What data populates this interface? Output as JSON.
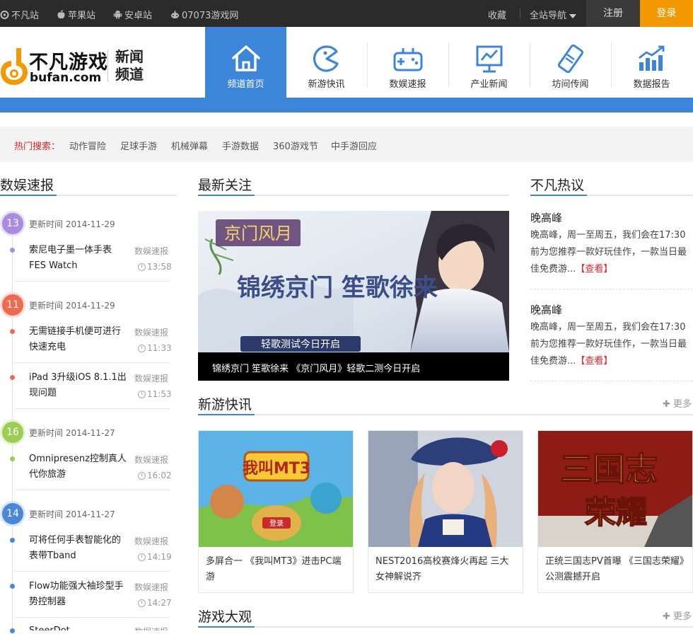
{
  "topbar": {
    "links": [
      {
        "label": "不凡站",
        "icon": "bufan-icon"
      },
      {
        "label": "苹果站",
        "icon": "apple-icon"
      },
      {
        "label": "安卓站",
        "icon": "android-icon"
      },
      {
        "label": "07073游戏网",
        "icon": "gamepad-icon"
      }
    ],
    "favorites": "收藏",
    "site_nav": "全站导航",
    "register": "注册",
    "login": "登录"
  },
  "header": {
    "logo_cn": "不凡游戏",
    "logo_en": "bufan.com",
    "channel": "新闻频道",
    "nav": [
      {
        "label": "频道首页",
        "icon": "home-icon",
        "active": true
      },
      {
        "label": "新游快讯",
        "icon": "pacman-icon",
        "active": false
      },
      {
        "label": "数娱速报",
        "icon": "gamepad-icon",
        "active": false
      },
      {
        "label": "产业新闻",
        "icon": "chart-monitor-icon",
        "active": false
      },
      {
        "label": "坊间传闻",
        "icon": "phone-icon",
        "active": false
      },
      {
        "label": "数据报告",
        "icon": "bar-chart-icon",
        "active": false
      }
    ]
  },
  "hot_search": {
    "label": "热门搜索：",
    "terms": [
      "动作冒险",
      "足球手游",
      "机械弹幕",
      "手游数据",
      "360游戏节",
      "中手游回应"
    ]
  },
  "left": {
    "title": "数娱速报",
    "date_prefix": "更新时间",
    "groups": [
      {
        "day": "13",
        "date": "2014-11-29",
        "color": "#a98be0",
        "items": [
          {
            "title": "索尼电子墨一体手表FES Watch",
            "cat": "数娱速报",
            "time": "13:58"
          }
        ]
      },
      {
        "day": "11",
        "date": "2014-11-29",
        "color": "#ef6a4e",
        "items": [
          {
            "title": "无需链接手机便可进行快速充电",
            "cat": "数娱速报",
            "time": "11:33"
          },
          {
            "title": "iPad 3升级iOS 8.1.1出现问题",
            "cat": "数娱速报",
            "time": "11:53"
          }
        ]
      },
      {
        "day": "16",
        "date": "2014-11-27",
        "color": "#9ccd55",
        "items": [
          {
            "title": "Omnipresenz控制真人代你旅游",
            "cat": "数娱速报",
            "time": "16:02"
          }
        ]
      },
      {
        "day": "14",
        "date": "2014-11-27",
        "color": "#4a87d6",
        "items": [
          {
            "title": "可将任何手表智能化的表带Tband",
            "cat": "数娱速报",
            "time": "14:19"
          },
          {
            "title": "Flow功能强大袖珍型手势控制器",
            "cat": "数娱速报",
            "time": "14:27"
          },
          {
            "title": "SteerDot…",
            "cat": "数据速报",
            "time": ""
          }
        ]
      }
    ]
  },
  "center": {
    "title": "最新关注",
    "banner_logo": "京门风月",
    "banner_headline": "锦绣京门 笙歌徐来",
    "banner_sub": "轻歌测试今日开启",
    "caption": "锦绣京门 笙歌徐来 《京门风月》轻歌二测今日开启",
    "newgames_title": "新游快讯",
    "more": "更多",
    "cards": [
      {
        "title": "多屏合一 《我叫MT3》进击PC端游",
        "art": "我叫MT3",
        "button": "登录"
      },
      {
        "title": "NEST2016高校赛烽火再起 三大女神解说齐",
        "art": ""
      },
      {
        "title": "正统三国志PV首曝 《三国志荣耀》公测震撼开启",
        "art": "三国志",
        "art2": "荣耀"
      }
    ],
    "overview_title": "游戏大观",
    "overview_more": "更多"
  },
  "right": {
    "title": "不凡热议",
    "items": [
      {
        "title": "晚高峰",
        "desc": "晚高峰，周一至周五，我们会在17:30前为您推荐一款好玩佳作，一款当日最佳免费游...",
        "link": "【查看】"
      },
      {
        "title": "晚高峰",
        "desc": "晚高峰，周一至周五，我们会在17:30前为您推荐一款好玩佳作，一款当日最佳免费游...",
        "link": "【查看】"
      }
    ]
  }
}
